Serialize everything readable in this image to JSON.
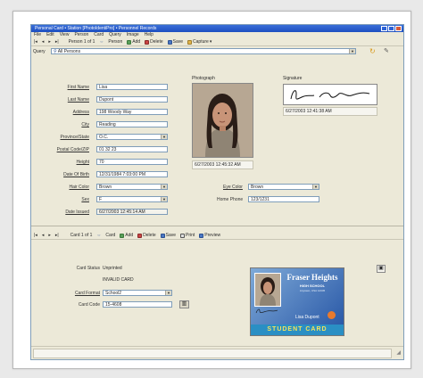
{
  "window": {
    "title": "Personal Card • Station  [PhotoIdentiPro] • Personnel Records"
  },
  "menu": [
    "File",
    "Edit",
    "View",
    "Person",
    "Card",
    "Query",
    "Image",
    "Help"
  ],
  "person_toolbar": {
    "record": "Person 1 of 1",
    "entity": "Person",
    "add": "Add",
    "delete": "Delete",
    "save": "Save",
    "capture": "Capture"
  },
  "query": {
    "label": "Query",
    "value": "All Persons"
  },
  "person": {
    "first_name": {
      "label": "First Name",
      "value": "Lisa"
    },
    "last_name": {
      "label": "Last Name",
      "value": "Dupont"
    },
    "address": {
      "label": "Address",
      "value": "198 Woody Way"
    },
    "city": {
      "label": "City",
      "value": "Reading"
    },
    "province": {
      "label": "Province/State",
      "value": "O.C."
    },
    "postal": {
      "label": "Postal Code/ZIP",
      "value": "01 32 23"
    },
    "height": {
      "label": "Height",
      "value": "70"
    },
    "dob": {
      "label": "Date Of Birth",
      "value": "12/31/1984 7:03:00 PM"
    },
    "hair": {
      "label": "Hair Color",
      "value": "Brown"
    },
    "sex": {
      "label": "Sex",
      "value": "F"
    },
    "issued": {
      "label": "Date Issued",
      "value": "6/27/2003 12:45:14 AM"
    },
    "eye": {
      "label": "Eye Color",
      "value": "Brown"
    },
    "phone": {
      "label": "Home Phone",
      "value": "123/1231"
    }
  },
  "photograph": {
    "label": "Photograph",
    "timestamp": "6/27/2003 12:45:32 AM"
  },
  "signature": {
    "label": "Signature",
    "name": "Lisa Dupont",
    "timestamp": "6/27/2003 12:41:38 AM"
  },
  "card_toolbar": {
    "record": "Card 1 of 1",
    "entity": "Card",
    "add": "Add",
    "delete": "Delete",
    "save": "Save",
    "print": "Print",
    "preview": "Preview"
  },
  "card": {
    "status": {
      "label": "Card Status",
      "value": "Unprinted"
    },
    "validity": "INVALID CARD",
    "format": {
      "label": "Card Format",
      "value": "School2"
    },
    "code": {
      "label": "Card Code",
      "value": "15-4608"
    }
  },
  "card_preview": {
    "school_line1": "Fraser Heights",
    "school_line2": "HIGH SCHOOL",
    "fine_print": "Anytown, USA 12345",
    "name": "Lisa Dupont",
    "banner": "STUDENT CARD"
  },
  "colors": {
    "accent": "#1d4fc0",
    "card_banner": "#2a8fc4",
    "card_bg": "#2b5aa8"
  }
}
